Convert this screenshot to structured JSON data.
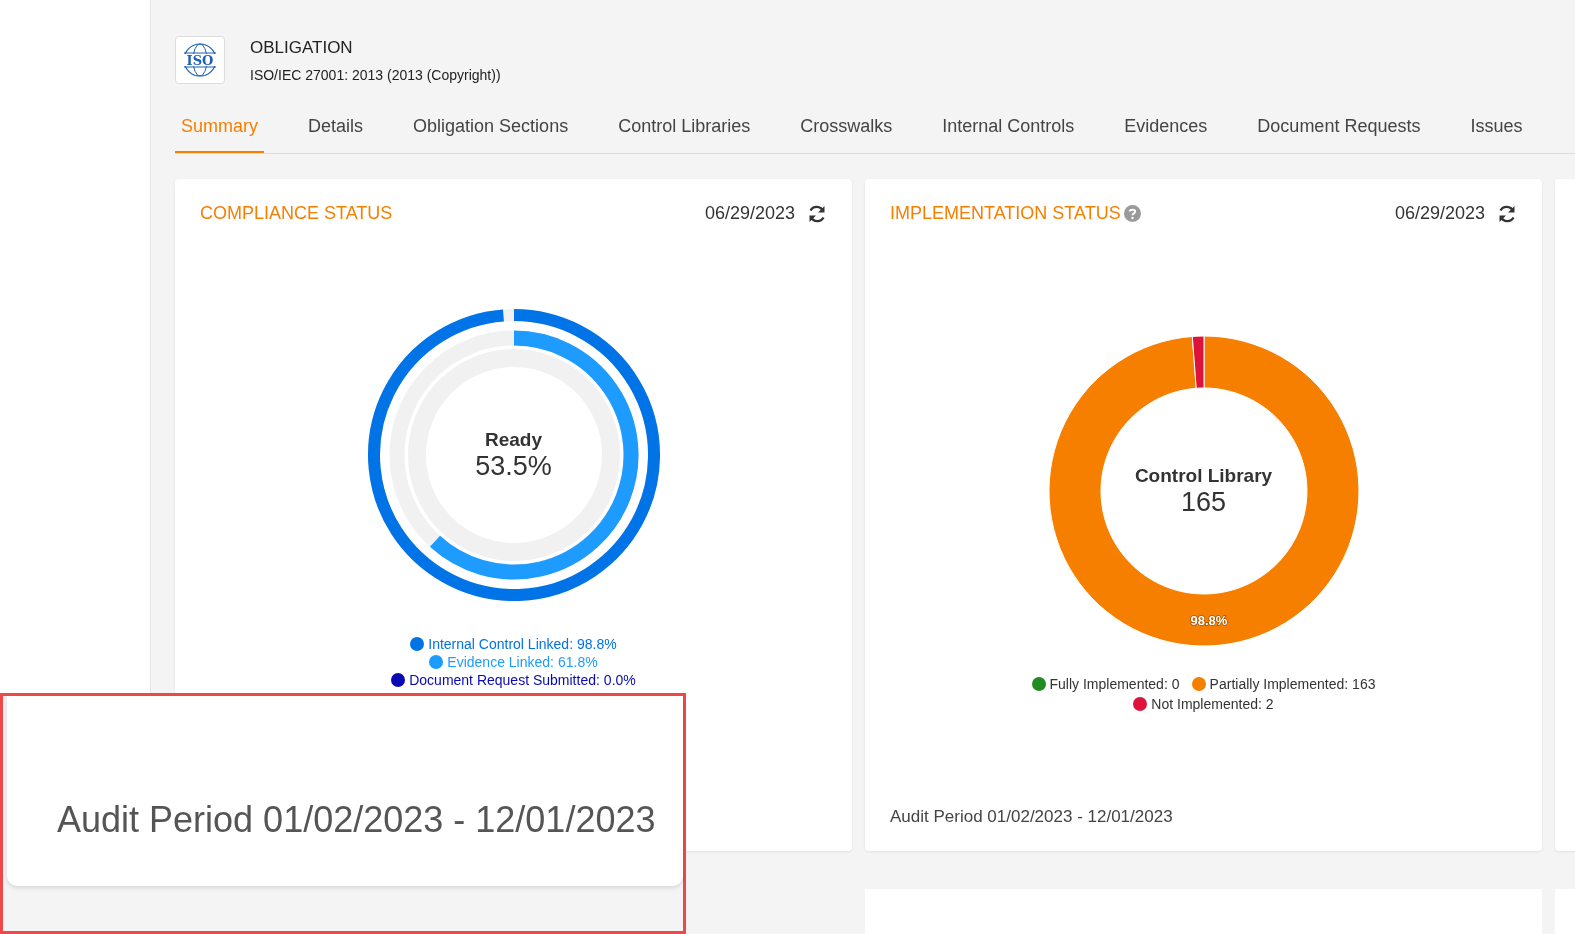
{
  "header": {
    "logo_text": "ISO",
    "title": "OBLIGATION",
    "subtitle": "ISO/IEC 27001: 2013 (2013 (Copyright))"
  },
  "tabs": [
    {
      "label": "Summary",
      "selected": true
    },
    {
      "label": "Details",
      "selected": false
    },
    {
      "label": "Obligation Sections",
      "selected": false
    },
    {
      "label": "Control Libraries",
      "selected": false
    },
    {
      "label": "Crosswalks",
      "selected": false
    },
    {
      "label": "Internal Controls",
      "selected": false
    },
    {
      "label": "Evidences",
      "selected": false
    },
    {
      "label": "Document Requests",
      "selected": false
    },
    {
      "label": "Issues",
      "selected": false
    }
  ],
  "cards": [
    {
      "title": "COMPLIANCE STATUS",
      "help": false,
      "date": "06/29/2023",
      "center_label": "Ready",
      "center_value": "53.5%",
      "chart_data": {
        "type": "other",
        "values": [
          98.8,
          61.8,
          0.0
        ],
        "value_labels": [
          "98.8%",
          "61.8%",
          "0.0%"
        ]
      },
      "legend": [
        {
          "name": "Internal Control Linked:",
          "color": "#0073e6"
        },
        {
          "name": "Evidence Linked:",
          "color": "#1e9bff"
        },
        {
          "name": "Document Request Submitted:",
          "color": "#0a0ab4"
        }
      ]
    },
    {
      "title": "IMPLEMENTATION STATUS",
      "help": true,
      "date": "06/29/2023",
      "center_label": "Control Library",
      "center_value": "165",
      "audit_period": "Audit Period 01/02/2023 - 12/01/2023",
      "chart_data": {
        "type": "donut",
        "values": [
          0,
          98.8,
          1.2
        ],
        "value_labels": [
          null,
          "98.8%",
          null
        ]
      },
      "legend": [
        {
          "name": "Fully Implemented:",
          "value": "0",
          "color": "#228b22"
        },
        {
          "name": "Partially Implemented:",
          "value": "163",
          "color": "#f77f00"
        },
        {
          "name": "Not Implemented:",
          "value": "2",
          "color": "#dc143c"
        }
      ]
    }
  ],
  "zoom_callout": {
    "text": "Audit Period 01/02/2023 - 12/01/2023"
  }
}
